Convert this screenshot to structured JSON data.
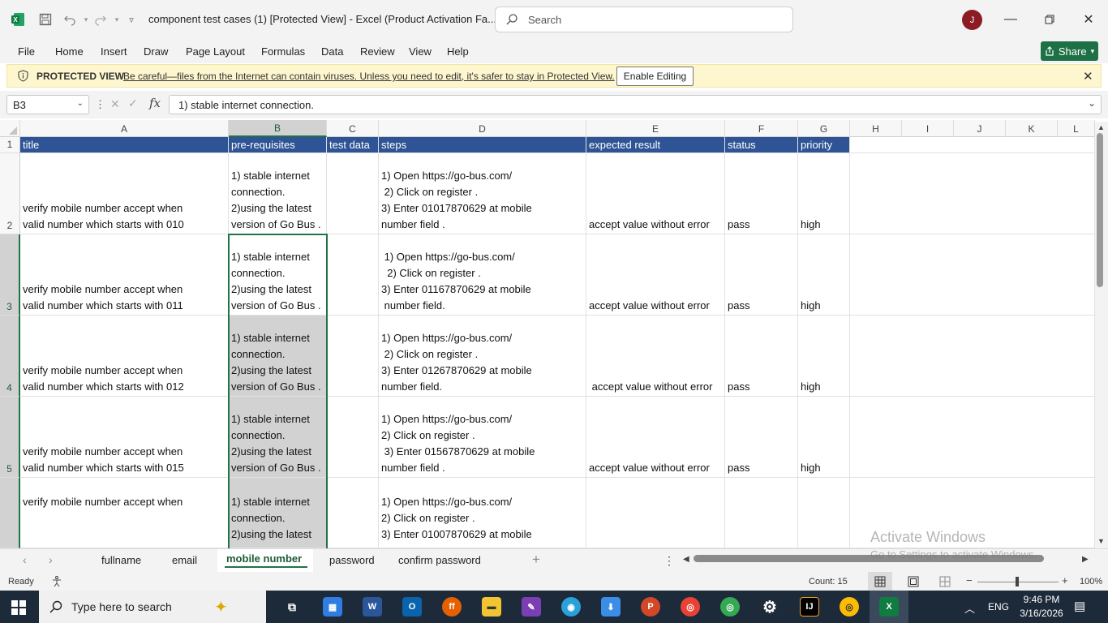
{
  "titlebar": {
    "doc_title": "component test cases (1)  [Protected View]  -  Excel (Product Activation Fa...",
    "search_placeholder": "Search",
    "avatar_initial": "J"
  },
  "menu": [
    "File",
    "Home",
    "Insert",
    "Draw",
    "Page Layout",
    "Formulas",
    "Data",
    "Review",
    "View",
    "Help"
  ],
  "share_label": "Share",
  "protected_view": {
    "label": "PROTECTED VIEW",
    "message": "Be careful—files from the Internet can contain viruses. Unless you need to edit, it's safer to stay in Protected View.",
    "enable_button": "Enable Editing"
  },
  "formula_bar": {
    "name_box": "B3",
    "fx": "fx",
    "value": "1) stable internet connection."
  },
  "columns": [
    "A",
    "B",
    "C",
    "D",
    "E",
    "F",
    "G",
    "H",
    "I",
    "J",
    "K",
    "L"
  ],
  "row_numbers": [
    "1",
    "2",
    "3",
    "4",
    "5",
    ""
  ],
  "header_row": [
    "title",
    "pre-requisites",
    "test data",
    "steps",
    "expected result",
    "status",
    "priority"
  ],
  "rows": [
    {
      "title": [
        "verify mobile number accept when",
        "valid number which starts with 010"
      ],
      "pre": [
        "1) stable internet",
        "connection.",
        "2)using the latest",
        "version of Go Bus ."
      ],
      "data": "",
      "steps": [
        "1) Open https://go-bus.com/",
        " 2) Click on register .",
        "3) Enter 01017870629 at mobile",
        "number field ."
      ],
      "expected": "accept value without error",
      "status": "pass",
      "priority": "high"
    },
    {
      "title": [
        "verify mobile number accept when",
        "valid number which starts with 011"
      ],
      "pre": [
        "1) stable internet",
        "connection.",
        "2)using the latest",
        "version of Go Bus ."
      ],
      "data": "",
      "steps": [
        " 1) Open https://go-bus.com/",
        "  2) Click on register .",
        "3) Enter 01167870629 at mobile",
        " number field."
      ],
      "expected": "accept value without error",
      "status": "pass",
      "priority": "high"
    },
    {
      "title": [
        "verify mobile number accept when",
        "valid number which starts with 012"
      ],
      "pre": [
        "1) stable internet",
        "connection.",
        "2)using the latest",
        "version of Go Bus ."
      ],
      "data": "",
      "steps": [
        "1) Open https://go-bus.com/",
        " 2) Click on register .",
        "3) Enter 01267870629 at mobile",
        "number field."
      ],
      "expected": " accept value without error",
      "status": "pass",
      "priority": "high"
    },
    {
      "title": [
        "verify mobile number accept when",
        "valid number which starts with 015"
      ],
      "pre": [
        "1) stable internet",
        "connection.",
        "2)using the latest",
        "version of Go Bus ."
      ],
      "data": "",
      "steps": [
        "1) Open https://go-bus.com/",
        "2) Click on register .",
        " 3) Enter 01567870629 at mobile",
        "number field ."
      ],
      "expected": "accept value without error",
      "status": "pass",
      "priority": "high"
    },
    {
      "title": [
        "verify mobile number accept when"
      ],
      "pre": [
        "1) stable internet",
        "connection.",
        "2)using the latest"
      ],
      "data": "",
      "steps": [
        "1) Open https://go-bus.com/",
        "2) Click on register .",
        "3) Enter 01007870629 at mobile"
      ],
      "expected": "",
      "status": "",
      "priority": ""
    }
  ],
  "sheet_tabs": [
    "fullname",
    "email",
    "mobile number",
    "password",
    "confirm password"
  ],
  "active_tab": "mobile number",
  "status": {
    "ready": "Ready",
    "count": "Count: 15",
    "zoom": "100%"
  },
  "watermark": {
    "line1": "Activate Windows",
    "line2": "Go to Settings to activate Windows."
  },
  "taskbar": {
    "search_placeholder": "Type here to search",
    "language": "ENG",
    "time": "9:46 PM",
    "date": "3/16/2026"
  },
  "colors": {
    "excel_green": "#217346",
    "header_fill": "#2f5496",
    "selection_grey": "#d2d2d2"
  }
}
